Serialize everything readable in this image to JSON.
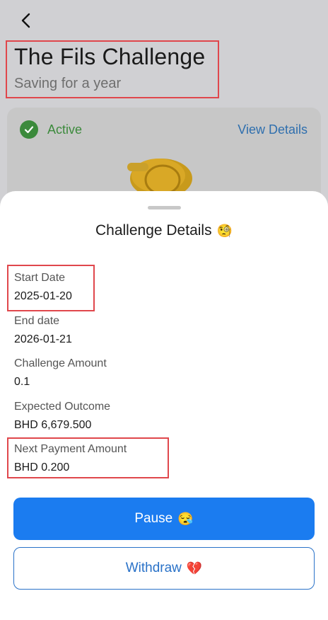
{
  "header": {
    "title": "The Fils Challenge",
    "subtitle": "Saving for a year",
    "back_icon": "chevron-left-icon"
  },
  "status_card": {
    "status": "Active",
    "status_icon": "check-circle-icon",
    "view_details_label": "View Details",
    "status_color": "#3c8a3c"
  },
  "sheet": {
    "title": "Challenge Details",
    "title_emoji": "🧐",
    "fields": [
      {
        "label": "Start Date",
        "value": "2025-01-20"
      },
      {
        "label": "End date",
        "value": "2026-01-21"
      },
      {
        "label": "Challenge Amount",
        "value": "0.1"
      },
      {
        "label": "Expected Outcome",
        "value": "BHD 6,679.500"
      },
      {
        "label": "Next Payment Amount",
        "value": "BHD 0.200"
      }
    ],
    "pause_label": "Pause",
    "pause_emoji": "😪",
    "withdraw_label": "Withdraw",
    "withdraw_emoji": "💔"
  },
  "colors": {
    "primary": "#1b7cf0",
    "highlight": "#e0474c",
    "link": "#2f6fae"
  }
}
